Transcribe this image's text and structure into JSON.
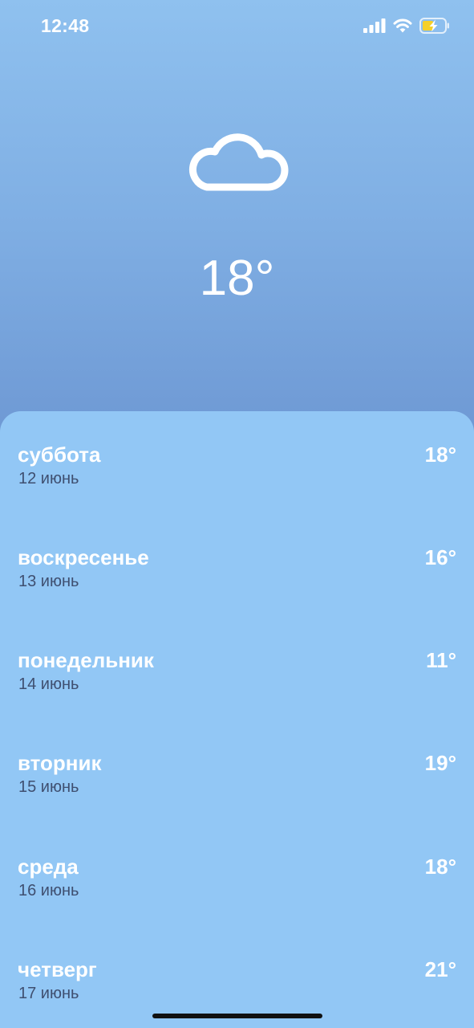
{
  "status_bar": {
    "time": "12:48",
    "icons": [
      "cellular-signal-icon",
      "wifi-icon",
      "battery-charging-icon"
    ],
    "battery_color": "#f5d02a"
  },
  "current": {
    "condition_icon": "cloud-icon",
    "temperature": "18°"
  },
  "forecast": [
    {
      "day": "суббота",
      "date": "12 июнь",
      "temp": "18°"
    },
    {
      "day": "воскресенье",
      "date": "13 июнь",
      "temp": "16°"
    },
    {
      "day": "понедельник",
      "date": "14 июнь",
      "temp": "11°"
    },
    {
      "day": "вторник",
      "date": "15 июнь",
      "temp": "19°"
    },
    {
      "day": "среда",
      "date": "16 июнь",
      "temp": "18°"
    },
    {
      "day": "четверг",
      "date": "17 июнь",
      "temp": "21°"
    }
  ],
  "colors": {
    "panel_background": "#92c7f5",
    "gradient_top": "#8fc1ef",
    "gradient_bottom": "#4f6db0",
    "date_text": "#3f4f70"
  }
}
